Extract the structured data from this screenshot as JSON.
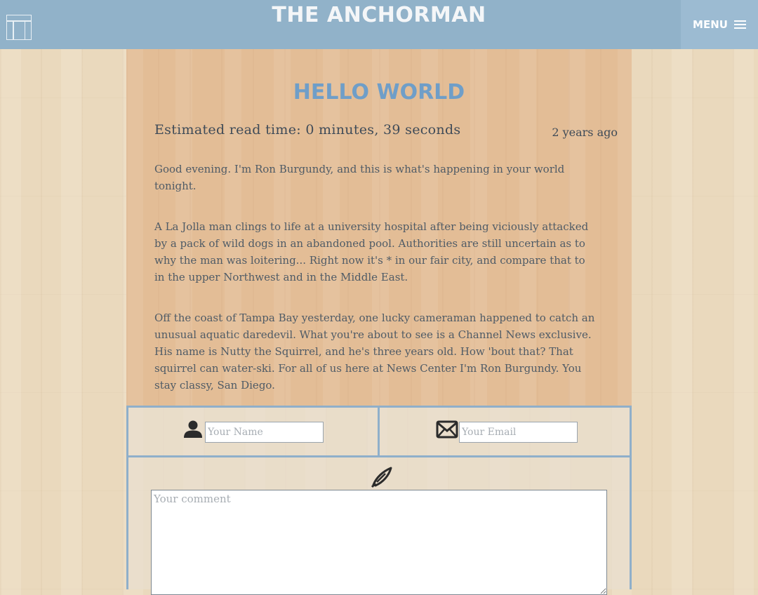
{
  "header": {
    "site_title": "THE ANCHORMAN",
    "menu_label": "MENU",
    "logo_icon": "blog-logo-icon",
    "menu_icon": "hamburger-icon"
  },
  "post": {
    "title": "HELLO WORLD",
    "read_time": "Estimated read time: 0 minutes, 39 seconds",
    "date": "2 years ago",
    "paragraphs": [
      "Good evening. I'm Ron Burgundy, and this is what's happening in your world tonight.",
      "A La Jolla man clings to life at a university hospital after being viciously attacked by a pack of wild dogs in an abandoned pool. Authorities are still uncertain as to why the man was loitering... Right now it's * in our fair city, and compare that to in the upper Northwest and in the Middle East.",
      "Off the coast of Tampa Bay yesterday, one lucky cameraman happened to catch an unusual aquatic daredevil. What you're about to see is a Channel News exclusive. His name is Nutty the Squirrel, and he's three years old. How 'bout that? That squirrel can water-ski. For all of us here at News Center I'm Ron Burgundy. You stay classy, San Diego."
    ]
  },
  "comment_form": {
    "name_placeholder": "Your Name",
    "name_value": "",
    "email_placeholder": "Your Email",
    "email_value": "",
    "comment_placeholder": "Your comment",
    "comment_value": "",
    "name_icon": "user-icon",
    "email_icon": "envelope-icon",
    "comment_icon": "pencil-icon"
  },
  "colors": {
    "header_bg": "#91b2c9",
    "accent": "#6f9ec8",
    "form_border": "#8fafca"
  }
}
